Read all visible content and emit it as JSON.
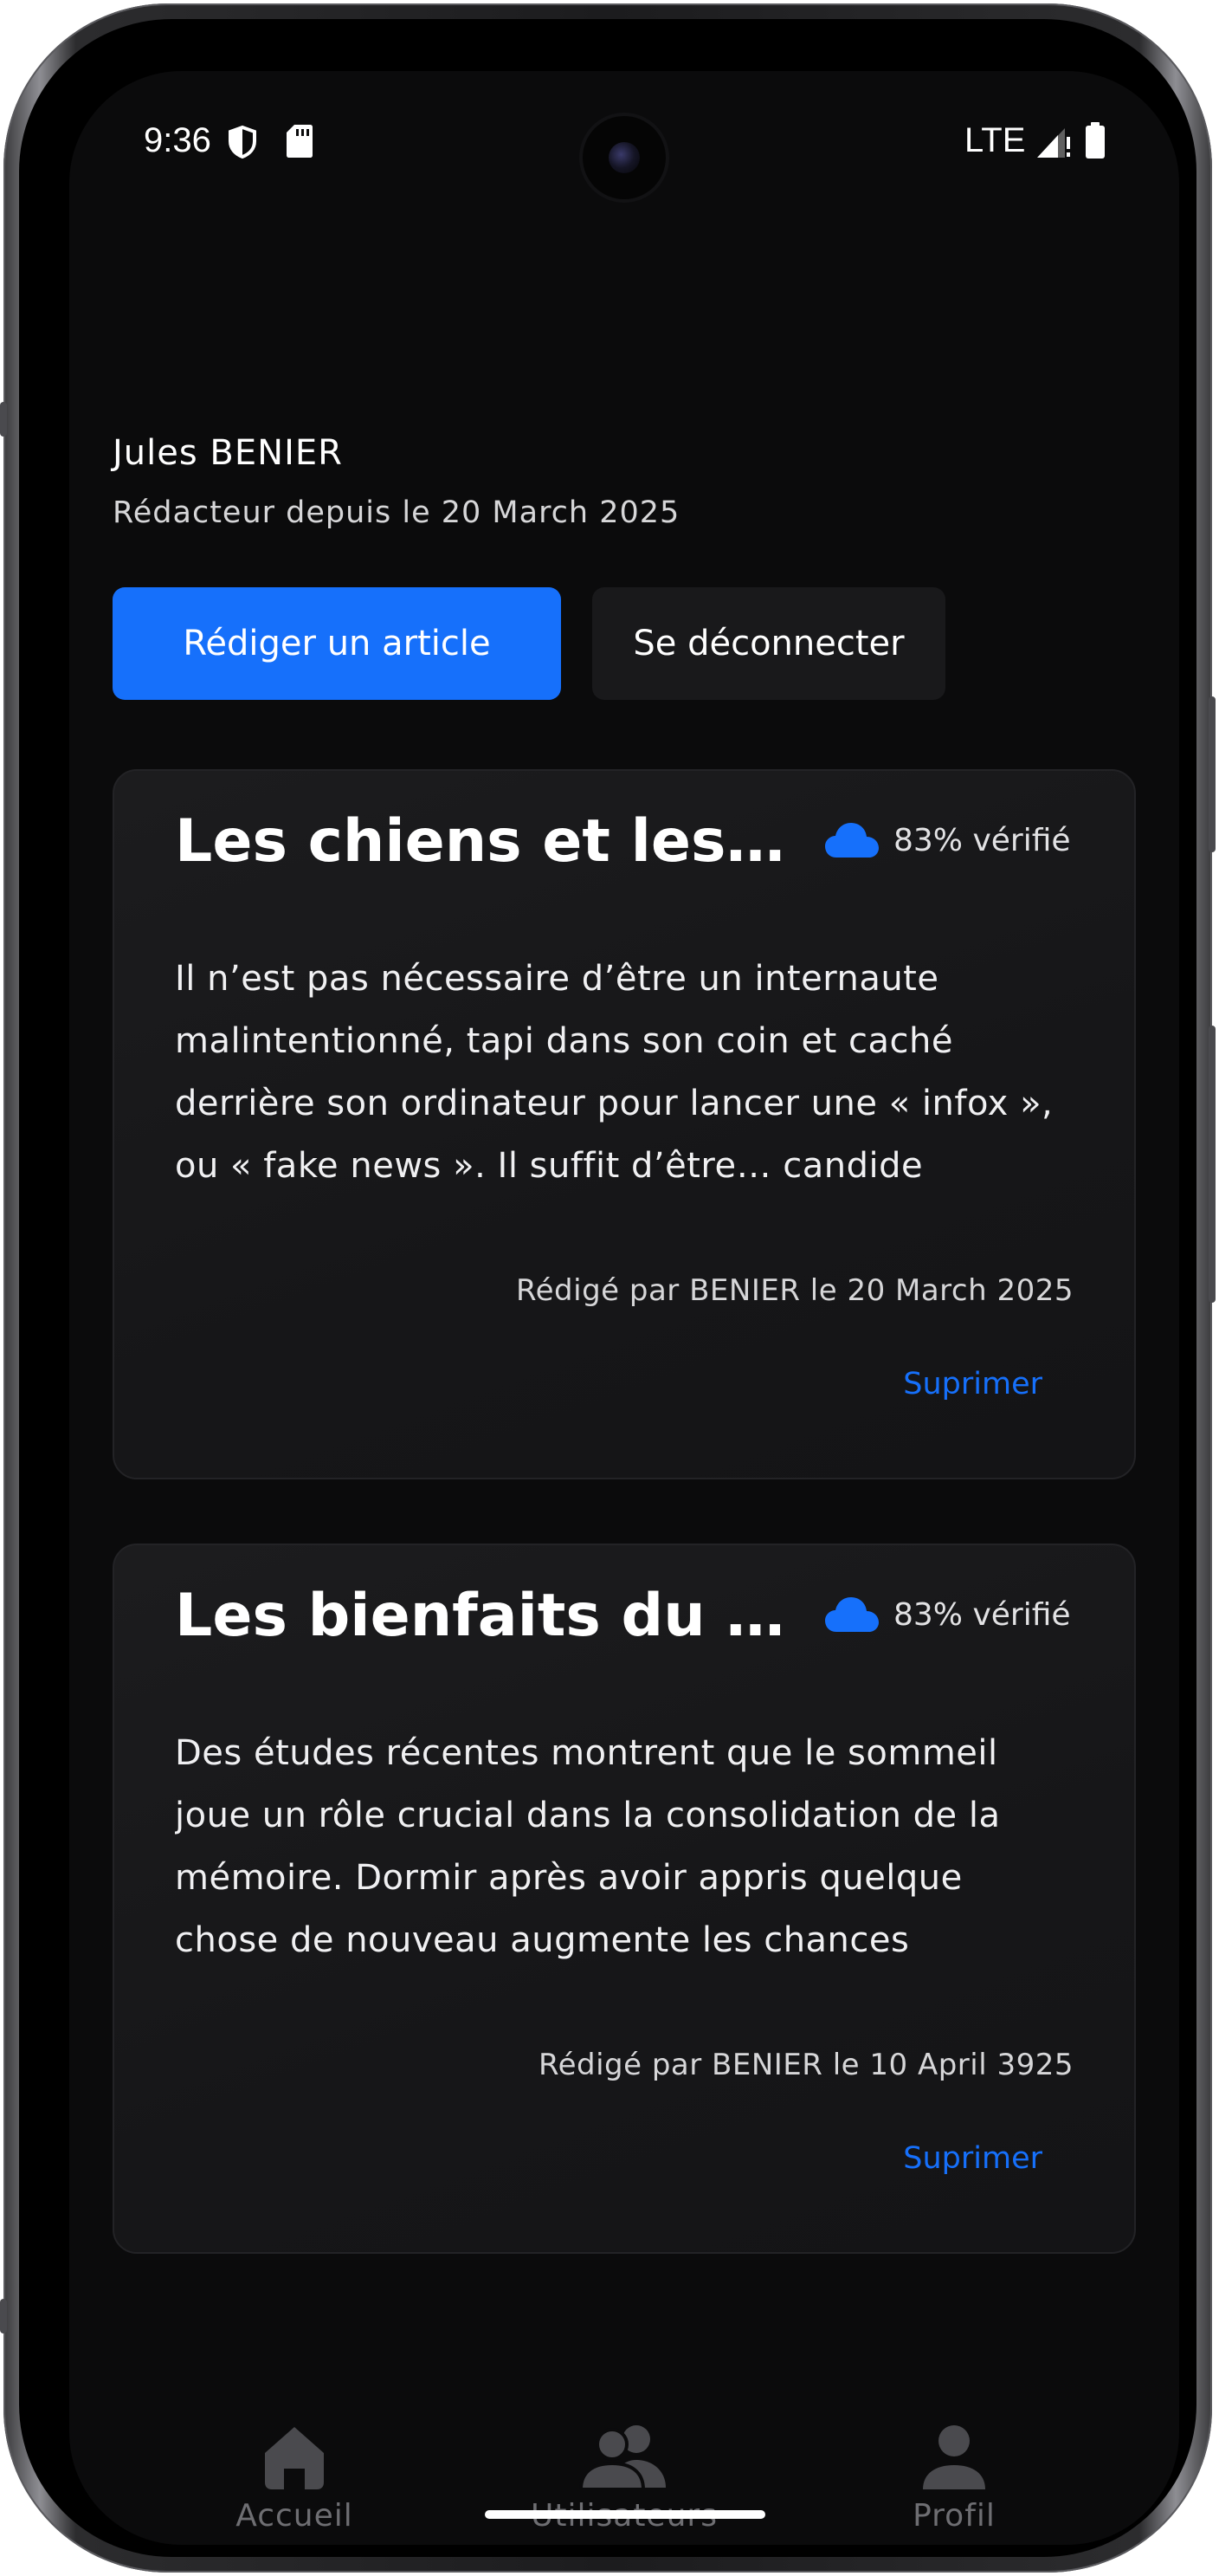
{
  "status_bar": {
    "time": "9:36",
    "network": "LTE",
    "icons": [
      "shield-icon",
      "sd-card-icon",
      "signal-icon",
      "battery-icon"
    ]
  },
  "profile": {
    "name": "Jules BENIER",
    "member_since": "Rédacteur depuis le 20 March 2025"
  },
  "actions": {
    "write_article": "Rédiger un article",
    "logout": "Se déconnecter"
  },
  "articles": [
    {
      "title": "Les chiens et les chats",
      "verification": "83% vérifié",
      "excerpt": "Il n’est pas nécessaire d’être un internaute malintentionné, tapi dans son coin et caché derrière son ordinateur pour lancer une « infox », ou « fake news ». Il suffit d’être… candide",
      "meta": "Rédigé par BENIER le 20 March 2025",
      "delete_label": "Suprimer"
    },
    {
      "title": "Les bienfaits du sommeil",
      "verification": "83% vérifié",
      "excerpt": "Des études récentes montrent que le sommeil joue un rôle crucial dans la consolidation de la mémoire. Dormir après avoir appris quelque chose de nouveau augmente les chances",
      "meta": "Rédigé par BENIER le 10 April 3925",
      "delete_label": "Suprimer"
    }
  ],
  "bottom_nav": {
    "items": [
      {
        "label": "Accueil",
        "icon": "home-icon"
      },
      {
        "label": "Utilisateurs",
        "icon": "users-icon"
      },
      {
        "label": "Profil",
        "icon": "person-icon"
      }
    ]
  },
  "colors": {
    "accent": "#1670fb",
    "background": "#0b0b0c",
    "card": "#1a1a1c",
    "nav_inactive": "#6e6e72"
  }
}
